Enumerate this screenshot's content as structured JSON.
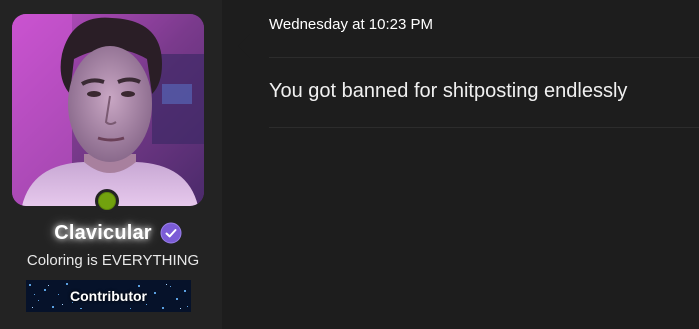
{
  "user": {
    "username": "Clavicular",
    "title": "Coloring is EVERYTHING",
    "banner_label": "Contributor",
    "online": true,
    "verified": true,
    "avatar_description_icon": "avatar-photo",
    "colors": {
      "online": "#72a20e",
      "verified_badge": "#7b5cd6"
    }
  },
  "message": {
    "timestamp": "Wednesday at 10:23 PM",
    "body": "You got banned for shitposting endlessly"
  }
}
